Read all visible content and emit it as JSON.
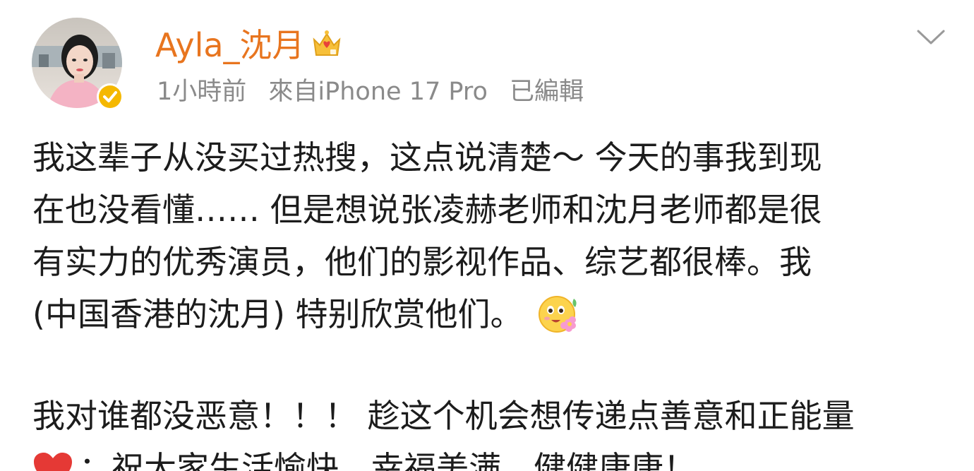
{
  "post": {
    "author": {
      "name": "Ayla_沈月",
      "avatar_icon": "avatar-photo",
      "verified_icon": "verified-check-icon",
      "member_icon": "crown-icon",
      "name_color": "#e8751f"
    },
    "meta": {
      "time": "1小時前",
      "source": "來自iPhone 17 Pro",
      "edited": "已編輯"
    },
    "menu_icon": "chevron-down-icon",
    "body": {
      "lines": [
        "我这辈子从没买过热搜，这点说清楚～ 今天的事我到现",
        "在也没看懂…… 但是想说张凌赫老师和沈月老师都是很",
        "有实力的优秀演员，他们的影视作品、综艺都很棒。我",
        "(中国香港的沈月) 特别欣赏他们。"
      ],
      "emoji": "flower-face-emoji",
      "paragraph2": [
        "我对谁都没恶意！！！ 趁这个机会想传递点善意和正能量",
        "：祝大家生活愉快，幸福美满，健健康康！"
      ],
      "heart_icon": "red-heart-icon"
    }
  }
}
